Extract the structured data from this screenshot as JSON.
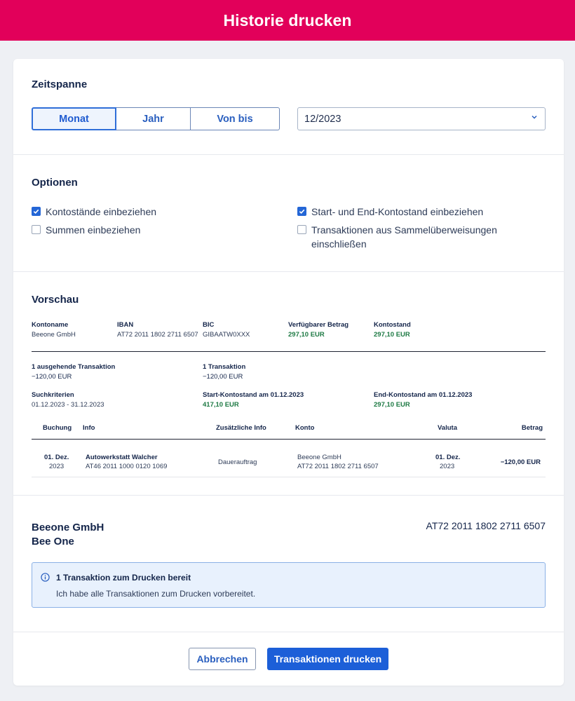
{
  "header": {
    "title": "Historie drucken"
  },
  "timespan": {
    "title": "Zeitspanne",
    "tabs": [
      "Monat",
      "Jahr",
      "Von bis"
    ],
    "active_tab": "Monat",
    "period_value": "12/2023"
  },
  "options": {
    "title": "Optionen",
    "items": [
      {
        "label": "Kontostände einbeziehen",
        "checked": true
      },
      {
        "label": "Summen einbeziehen",
        "checked": false
      },
      {
        "label": "Start- und End-Kontostand einbeziehen",
        "checked": true
      },
      {
        "label": "Transaktionen aus Sammelüberweisungen einschließen",
        "checked": false
      }
    ]
  },
  "preview": {
    "title": "Vorschau",
    "account": {
      "kontoname_label": "Kontoname",
      "kontoname": "Beeone GmbH",
      "iban_label": "IBAN",
      "iban": "AT72 2011 1802 2711 6507",
      "bic_label": "BIC",
      "bic": "GIBAATW0XXX",
      "available_label": "Verfügbarer Betrag",
      "available": "297,10 EUR",
      "balance_label": "Kontostand",
      "balance": "297,10 EUR"
    },
    "summary": {
      "outgoing_label": "1 ausgehende Transaktion",
      "outgoing_value": "−120,00 EUR",
      "total_label": "1 Transaktion",
      "total_value": "−120,00 EUR",
      "criteria_label": "Suchkriterien",
      "criteria_value": "01.12.2023 - 31.12.2023",
      "start_label": "Start-Kontostand am 01.12.2023",
      "start_value": "417,10 EUR",
      "end_label": "End-Kontostand am 01.12.2023",
      "end_value": "297,10 EUR"
    },
    "table": {
      "headers": {
        "booking": "Buchung",
        "info": "Info",
        "extra": "Zusätzliche Info",
        "account": "Konto",
        "valuta": "Valuta",
        "amount": "Betrag"
      },
      "rows": [
        {
          "booking_day": "01. Dez.",
          "booking_year": "2023",
          "info_name": "Autowerkstatt Walcher",
          "info_iban": "AT46 2011 1000 0120 1069",
          "extra": "Dauerauftrag",
          "account_name": "Beeone GmbH",
          "account_iban": "AT72 2011 1802 2711 6507",
          "valuta_day": "01. Dez.",
          "valuta_year": "2023",
          "amount": "−120,00 EUR"
        }
      ]
    }
  },
  "footer_info": {
    "company": "Beeone GmbH",
    "company_sub": "Bee One",
    "iban": "AT72 2011 1802 2711 6507",
    "alert_title": "1 Transaktion zum Drucken bereit",
    "alert_text": "Ich habe alle Transaktionen zum Drucken vorbereitet."
  },
  "actions": {
    "cancel": "Abbrechen",
    "print": "Transaktionen drucken"
  },
  "colors": {
    "brand": "#e2005a",
    "primary": "#1c5fd8",
    "positive": "#1e7a44"
  }
}
